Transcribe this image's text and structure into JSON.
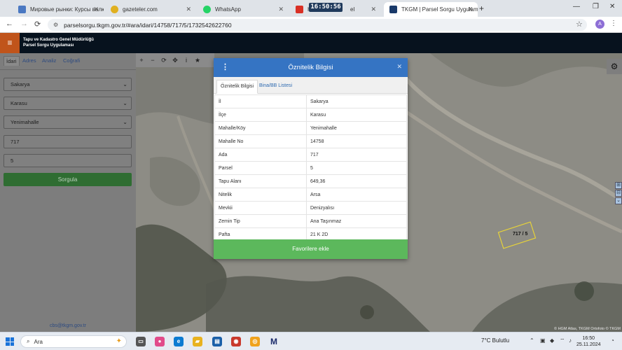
{
  "browser": {
    "tabs": [
      {
        "title": "Мировые рынки: Курсы валю",
        "icon_color": "#4a78c2"
      },
      {
        "title": "gazeteler.com",
        "icon_color": "#e0b020"
      },
      {
        "title": "WhatsApp",
        "icon_color": "#25d366"
      },
      {
        "title": "H",
        "suffix": "el",
        "icon_color": "#d93025"
      },
      {
        "title": "TKGM | Parsel Sorgu Uygulamas",
        "icon_color": "#1a3a6a"
      }
    ],
    "clock_badge": "16:50:56",
    "url": "parselsorgu.tkgm.gov.tr/#ara/idari/14758/717/5/1732542622760",
    "profile_letter": "A"
  },
  "app": {
    "agency_line1": "Tapu ve Kadastro Genel Müdürlüğü",
    "agency_line2": "Parsel Sorgu Uygulaması"
  },
  "left_panel": {
    "tabs": [
      "İdari",
      "Adres",
      "Analiz",
      "Coğrafi"
    ],
    "il": "Sakarya",
    "ilce": "Karasu",
    "mahalle": "Yenimahalle",
    "ada": "717",
    "parsel": "5",
    "submit_label": "Sorgula",
    "contact_email": "cbs@tkgm.gov.tr"
  },
  "map": {
    "tools": [
      "+",
      "−",
      "⟳",
      "✥",
      "i",
      "★"
    ],
    "parcel_label": "717 / 5",
    "attribution": "© HGM Atlas, TKGM Ortofoto © TKGM"
  },
  "modal": {
    "title": "Öznitelik Bilgisi",
    "tab_attributes": "Öznitelik Bilgisi",
    "tab_buildings": "Bina/BB Listesi",
    "rows": [
      {
        "key": "İl",
        "value": "Sakarya"
      },
      {
        "key": "İlçe",
        "value": "Karasu"
      },
      {
        "key": "Mahalle/Köy",
        "value": "Yenimahalle"
      },
      {
        "key": "Mahalle No",
        "value": "14758"
      },
      {
        "key": "Ada",
        "value": "717"
      },
      {
        "key": "Parsel",
        "value": "5"
      },
      {
        "key": "Tapu Alanı",
        "value": "649,36"
      },
      {
        "key": "Nitelik",
        "value": "Arsa"
      },
      {
        "key": "Mevkii",
        "value": "Denizyalısı"
      },
      {
        "key": "Zemin Tip",
        "value": "Ana Taşınmaz"
      },
      {
        "key": "Pafta",
        "value": "21 K 2D"
      }
    ],
    "favorite_label": "Favorilere ekle"
  },
  "taskbar": {
    "search_label": "Ara",
    "weather": "7°C  Bulutlu",
    "time": "16:50",
    "date": "25.11.2024"
  }
}
